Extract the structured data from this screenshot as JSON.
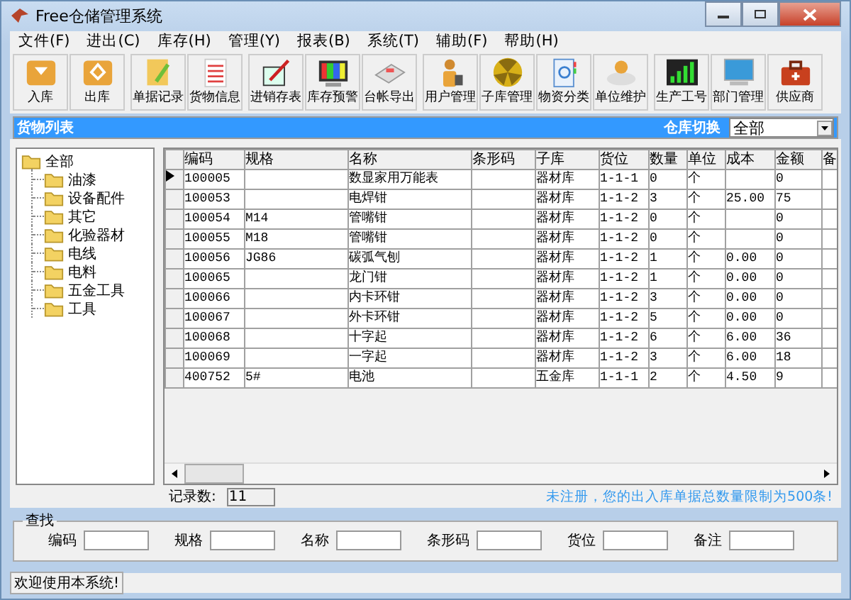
{
  "window": {
    "title": "Free仓储管理系统"
  },
  "menu": [
    "文件(F)",
    "进出(C)",
    "库存(H)",
    "管理(Y)",
    "报表(B)",
    "系统(T)",
    "辅助(F)",
    "帮助(H)"
  ],
  "toolbar": [
    {
      "label": "入库",
      "kind": "tray"
    },
    {
      "label": "出库",
      "kind": "tray-out"
    },
    {
      "label": "单据记录",
      "kind": "notepad"
    },
    {
      "label": "货物信息",
      "kind": "list"
    },
    {
      "label": "进销存表",
      "kind": "pen"
    },
    {
      "label": "库存预警",
      "kind": "monitor"
    },
    {
      "label": "台帐导出",
      "kind": "device"
    },
    {
      "label": "用户管理",
      "kind": "person"
    },
    {
      "label": "子库管理",
      "kind": "disc"
    },
    {
      "label": "物资分类",
      "kind": "book"
    },
    {
      "label": "单位维护",
      "kind": "cd"
    },
    {
      "label": "生产工号",
      "kind": "bars"
    },
    {
      "label": "部门管理",
      "kind": "screen"
    },
    {
      "label": "供应商",
      "kind": "toolbox"
    }
  ],
  "panel": {
    "title": "货物列表",
    "switch_label": "仓库切换",
    "warehouse": "全部"
  },
  "tree": {
    "label": "全部",
    "expanded": true,
    "children": [
      {
        "label": "油漆"
      },
      {
        "label": "设备配件"
      },
      {
        "label": "其它"
      },
      {
        "label": "化验器材"
      },
      {
        "label": "电线"
      },
      {
        "label": "电料"
      },
      {
        "label": "五金工具"
      },
      {
        "label": "工具"
      }
    ]
  },
  "table": {
    "columns": [
      "编码",
      "规格",
      "名称",
      "条形码",
      "子库",
      "货位",
      "数量",
      "单位",
      "成本",
      "金额",
      "备"
    ],
    "rows": [
      {
        "selected": true,
        "cells": [
          "100005",
          "",
          "数显家用万能表",
          "",
          "器材库",
          "1-1-1",
          "0",
          "个",
          "",
          "0",
          ""
        ]
      },
      {
        "selected": false,
        "cells": [
          "100053",
          "",
          "电焊钳",
          "",
          "器材库",
          "1-1-2",
          "3",
          "个",
          "25.00",
          "75",
          ""
        ]
      },
      {
        "selected": false,
        "cells": [
          "100054",
          "M14",
          "管嘴钳",
          "",
          "器材库",
          "1-1-2",
          "0",
          "个",
          "",
          "0",
          ""
        ]
      },
      {
        "selected": false,
        "cells": [
          "100055",
          "M18",
          "管嘴钳",
          "",
          "器材库",
          "1-1-2",
          "0",
          "个",
          "",
          "0",
          ""
        ]
      },
      {
        "selected": false,
        "cells": [
          "100056",
          "JG86",
          "碳弧气刨",
          "",
          "器材库",
          "1-1-2",
          "1",
          "个",
          "0.00",
          "0",
          ""
        ]
      },
      {
        "selected": false,
        "cells": [
          "100065",
          "",
          "龙门钳",
          "",
          "器材库",
          "1-1-2",
          "1",
          "个",
          "0.00",
          "0",
          ""
        ]
      },
      {
        "selected": false,
        "cells": [
          "100066",
          "",
          "内卡环钳",
          "",
          "器材库",
          "1-1-2",
          "3",
          "个",
          "0.00",
          "0",
          ""
        ]
      },
      {
        "selected": false,
        "cells": [
          "100067",
          "",
          "外卡环钳",
          "",
          "器材库",
          "1-1-2",
          "5",
          "个",
          "0.00",
          "0",
          ""
        ]
      },
      {
        "selected": false,
        "cells": [
          "100068",
          "",
          "十字起",
          "",
          "器材库",
          "1-1-2",
          "6",
          "个",
          "6.00",
          "36",
          ""
        ]
      },
      {
        "selected": false,
        "cells": [
          "100069",
          "",
          "一字起",
          "",
          "器材库",
          "1-1-2",
          "3",
          "个",
          "6.00",
          "18",
          ""
        ]
      },
      {
        "selected": false,
        "cells": [
          "400752",
          "5#",
          "电池",
          "",
          "五金库",
          "1-1-1",
          "2",
          "个",
          "4.50",
          "9",
          ""
        ]
      }
    ]
  },
  "record_count": {
    "label": "记录数:",
    "value": "11"
  },
  "notice": "未注册，您的出入库单据总数量限制为500条!",
  "search": {
    "title": "查找",
    "fields": [
      "编码",
      "规格",
      "名称",
      "条形码",
      "货位",
      "备注"
    ]
  },
  "status_bar": "欢迎使用本系统!"
}
